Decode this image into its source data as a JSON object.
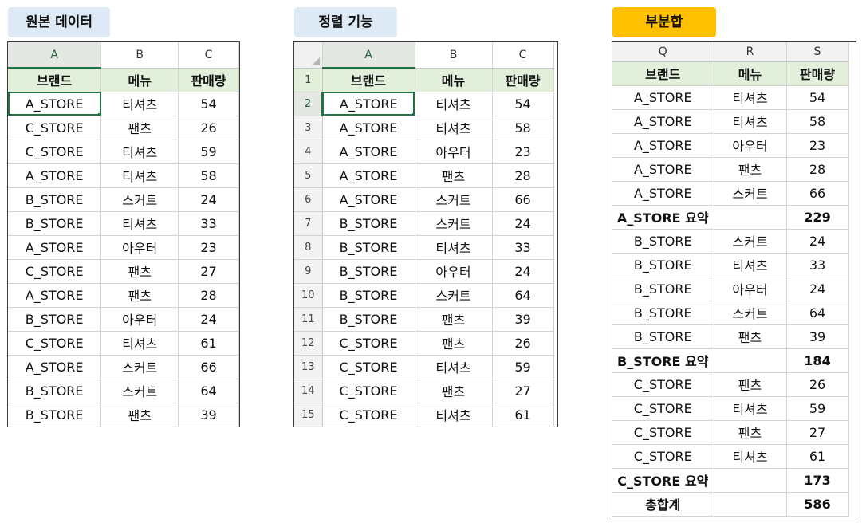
{
  "titles": {
    "original": "원본 데이터",
    "sort": "정렬 기능",
    "subtotal": "부분합"
  },
  "sheet1": {
    "columns": [
      "A",
      "B",
      "C"
    ],
    "headers": [
      "브랜드",
      "메뉴",
      "판매량"
    ],
    "rows": [
      [
        "A_STORE",
        "티셔츠",
        "54"
      ],
      [
        "C_STORE",
        "팬츠",
        "26"
      ],
      [
        "C_STORE",
        "티셔츠",
        "59"
      ],
      [
        "A_STORE",
        "티셔츠",
        "58"
      ],
      [
        "B_STORE",
        "스커트",
        "24"
      ],
      [
        "B_STORE",
        "티셔츠",
        "33"
      ],
      [
        "A_STORE",
        "아우터",
        "23"
      ],
      [
        "C_STORE",
        "팬츠",
        "27"
      ],
      [
        "A_STORE",
        "팬츠",
        "28"
      ],
      [
        "B_STORE",
        "아우터",
        "24"
      ],
      [
        "C_STORE",
        "티셔츠",
        "61"
      ],
      [
        "A_STORE",
        "스커트",
        "66"
      ],
      [
        "B_STORE",
        "스커트",
        "64"
      ],
      [
        "B_STORE",
        "팬츠",
        "39"
      ]
    ]
  },
  "sheet2": {
    "columns": [
      "A",
      "B",
      "C"
    ],
    "headers": [
      "브랜드",
      "메뉴",
      "판매량"
    ],
    "row_numbers": [
      "1",
      "2",
      "3",
      "4",
      "5",
      "6",
      "7",
      "8",
      "9",
      "10",
      "11",
      "12",
      "13",
      "14",
      "15"
    ],
    "rows": [
      [
        "A_STORE",
        "티셔츠",
        "54"
      ],
      [
        "A_STORE",
        "티셔츠",
        "58"
      ],
      [
        "A_STORE",
        "아우터",
        "23"
      ],
      [
        "A_STORE",
        "팬츠",
        "28"
      ],
      [
        "A_STORE",
        "스커트",
        "66"
      ],
      [
        "B_STORE",
        "스커트",
        "24"
      ],
      [
        "B_STORE",
        "티셔츠",
        "33"
      ],
      [
        "B_STORE",
        "아우터",
        "24"
      ],
      [
        "B_STORE",
        "스커트",
        "64"
      ],
      [
        "B_STORE",
        "팬츠",
        "39"
      ],
      [
        "C_STORE",
        "팬츠",
        "26"
      ],
      [
        "C_STORE",
        "티셔츠",
        "59"
      ],
      [
        "C_STORE",
        "팬츠",
        "27"
      ],
      [
        "C_STORE",
        "티셔츠",
        "61"
      ]
    ]
  },
  "sheet3": {
    "columns": [
      "Q",
      "R",
      "S"
    ],
    "headers": [
      "브랜드",
      "메뉴",
      "판매량"
    ],
    "rows": [
      [
        "A_STORE",
        "티셔츠",
        "54"
      ],
      [
        "A_STORE",
        "티셔츠",
        "58"
      ],
      [
        "A_STORE",
        "아우터",
        "23"
      ],
      [
        "A_STORE",
        "팬츠",
        "28"
      ],
      [
        "A_STORE",
        "스커트",
        "66"
      ],
      [
        "A_STORE 요약",
        "",
        "229"
      ],
      [
        "B_STORE",
        "스커트",
        "24"
      ],
      [
        "B_STORE",
        "티셔츠",
        "33"
      ],
      [
        "B_STORE",
        "아우터",
        "24"
      ],
      [
        "B_STORE",
        "스커트",
        "64"
      ],
      [
        "B_STORE",
        "팬츠",
        "39"
      ],
      [
        "B_STORE 요약",
        "",
        "184"
      ],
      [
        "C_STORE",
        "팬츠",
        "26"
      ],
      [
        "C_STORE",
        "티셔츠",
        "59"
      ],
      [
        "C_STORE",
        "팬츠",
        "27"
      ],
      [
        "C_STORE",
        "티셔츠",
        "61"
      ],
      [
        "C_STORE 요약",
        "",
        "173"
      ],
      [
        "총합계",
        "",
        "586"
      ]
    ],
    "summary_rows": [
      5,
      11,
      16,
      17
    ]
  },
  "colors": {
    "header_fill": "#e2efda",
    "excel_green": "#217346",
    "subtotal_badge": "#ffc000",
    "title_badge": "#dde9f5"
  }
}
